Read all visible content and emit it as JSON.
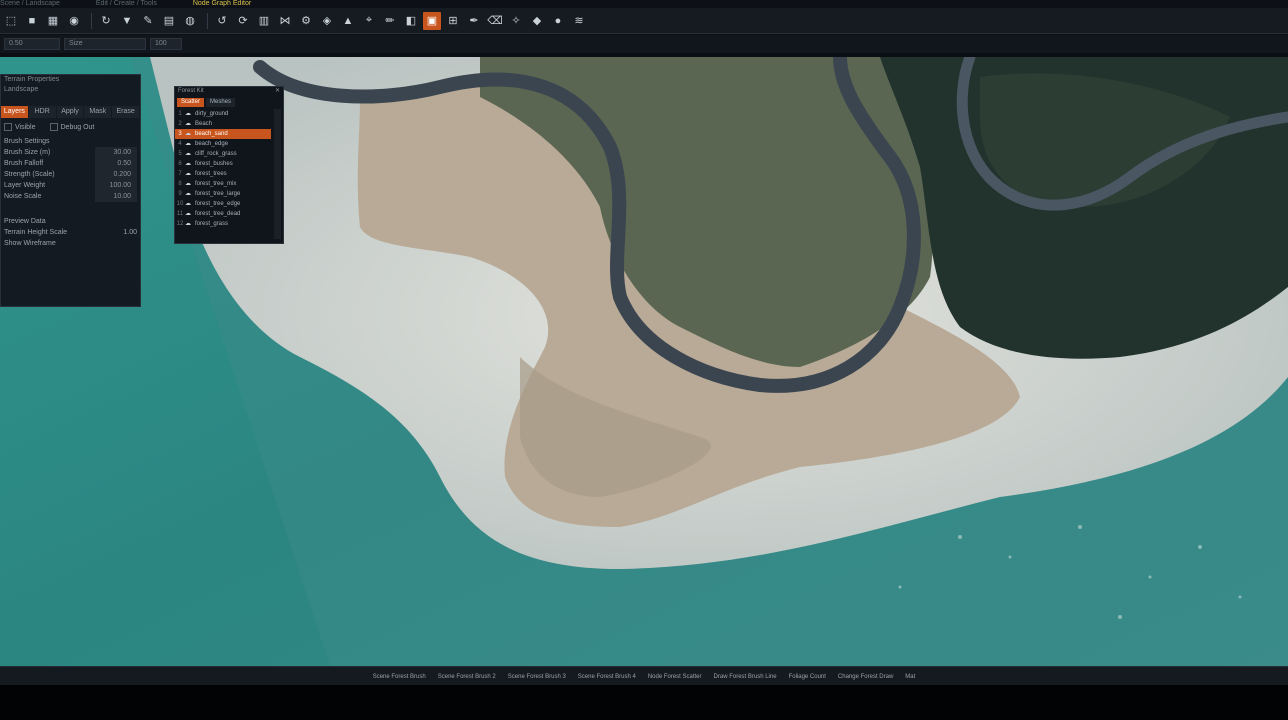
{
  "menubar": {
    "items": [
      "Scene / Landscape",
      "Edit / Create / Tools"
    ],
    "active_item": "Node Graph Editor"
  },
  "toolbar": {
    "icons": [
      "select-icon",
      "square-icon",
      "grid-icon",
      "camera-icon",
      "rotate-icon",
      "filter-icon",
      "brush-icon",
      "layer-icon",
      "globe-icon",
      "undo-icon",
      "refresh-icon",
      "stack-icon",
      "share-icon",
      "gear-icon",
      "paint-icon",
      "terrain-icon",
      "pin-icon",
      "pencil-icon",
      "fill-icon",
      "stamp-icon",
      "view-icon",
      "pen-icon",
      "erase-icon",
      "wand-icon",
      "package-icon",
      "droplet-icon",
      "wind-icon"
    ],
    "highlighted_index": 19
  },
  "subtoolbar": {
    "fields": [
      "0.50",
      "Size",
      "100"
    ]
  },
  "left_panel": {
    "title": "Terrain Properties",
    "subtitle": "Landscape",
    "tabs": [
      "Layers",
      "HDR",
      "Apply",
      "Mask",
      "Erase"
    ],
    "active_tab": 0,
    "toggles": [
      "Visible",
      "Debug Out"
    ],
    "section_title": "Brush Settings",
    "rows": [
      {
        "label": "Brush Size (m)",
        "value": "30.00"
      },
      {
        "label": "Brush Falloff",
        "value": "0.50"
      },
      {
        "label": "Strength (Scale)",
        "value": "0.200"
      },
      {
        "label": "Layer Weight",
        "value": "100.00"
      },
      {
        "label": "Noise Scale",
        "value": "10.00"
      }
    ],
    "section2_title": "Preview Data",
    "rows2": [
      {
        "label": "Terrain Height Scale",
        "value": "1.00"
      },
      {
        "label": "Show Wireframe",
        "value": ""
      }
    ]
  },
  "layer_panel": {
    "title": "Forest Kit",
    "tabs": [
      "Scatter",
      "Meshes"
    ],
    "active_tab": 0,
    "items": [
      {
        "num": "1",
        "label": "dirty_ground"
      },
      {
        "num": "2",
        "label": "Beach"
      },
      {
        "num": "3",
        "label": "beach_sand"
      },
      {
        "num": "4",
        "label": "beach_edge"
      },
      {
        "num": "5",
        "label": "cliff_rock_grass"
      },
      {
        "num": "6",
        "label": "forest_bushes"
      },
      {
        "num": "7",
        "label": "forest_trees"
      },
      {
        "num": "8",
        "label": "forest_tree_mix"
      },
      {
        "num": "9",
        "label": "forest_tree_large"
      },
      {
        "num": "10",
        "label": "forest_tree_edge"
      },
      {
        "num": "11",
        "label": "forest_tree_dead"
      },
      {
        "num": "12",
        "label": "forest_grass"
      }
    ],
    "selected_index": 2
  },
  "statusbar": {
    "items": [
      "Scene Forest Brush",
      "Scene Forest Brush 2",
      "Scene Forest Brush 3",
      "Scene Forest Brush 4",
      "Node Forest Scatter",
      "Draw Forest Brush Line",
      "Foliage Count",
      "Change Forest Draw",
      "Mat"
    ]
  },
  "colors": {
    "accent": "#c8551e",
    "panel_bg": "#141a21",
    "water": "#2e8a83",
    "road": "#3e4753",
    "sand": "#cfd0cb",
    "forest": "#2b3a33"
  }
}
